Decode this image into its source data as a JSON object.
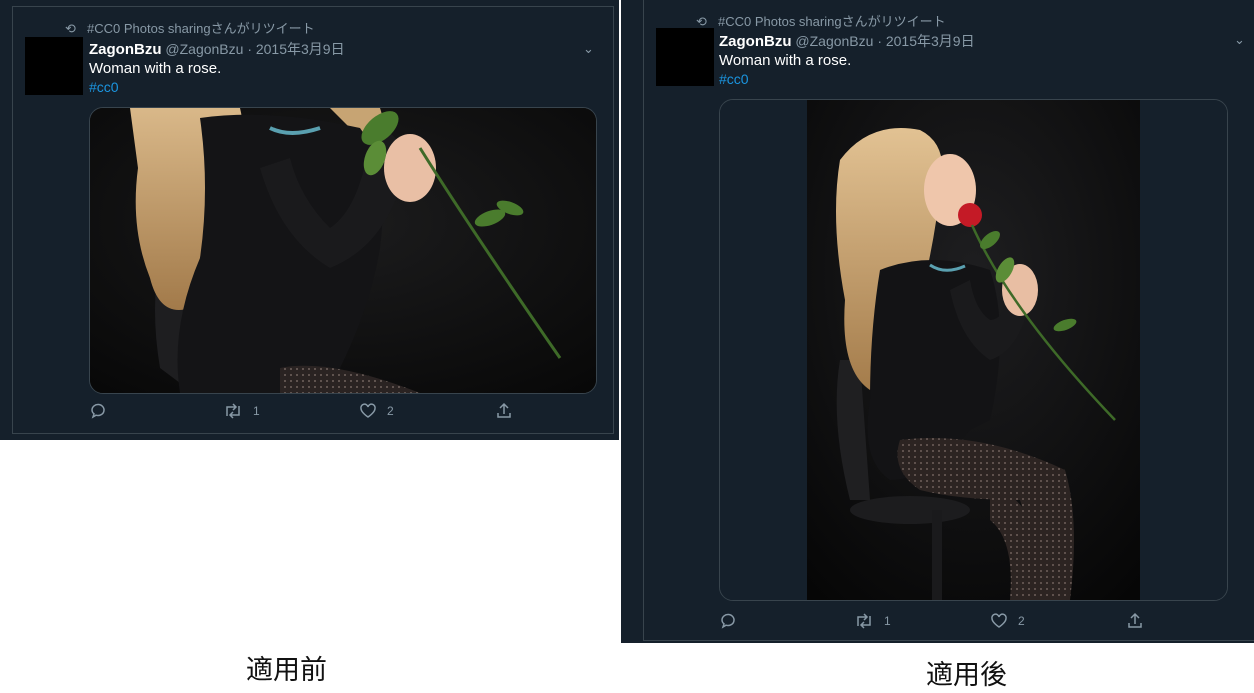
{
  "retweet_text": "#CC0 Photos sharingさんがリツイート",
  "tweet": {
    "display_name": "ZagonBzu",
    "handle_date": "@ZagonBzu · 2015年3月9日",
    "text": "Woman with a rose.",
    "hashtag": "#cc0",
    "retweet_count": "1",
    "like_count": "2"
  },
  "icons": {
    "retweet": "retweet-icon",
    "reply": "reply-icon",
    "like": "heart-icon",
    "share": "share-icon",
    "menu": "chevron-down-icon"
  },
  "captions": {
    "before": "適用前",
    "after": "適用後"
  },
  "colors": {
    "background": "#15202b",
    "border": "#38444d",
    "muted": "#8899a6",
    "link": "#1b95e0"
  }
}
